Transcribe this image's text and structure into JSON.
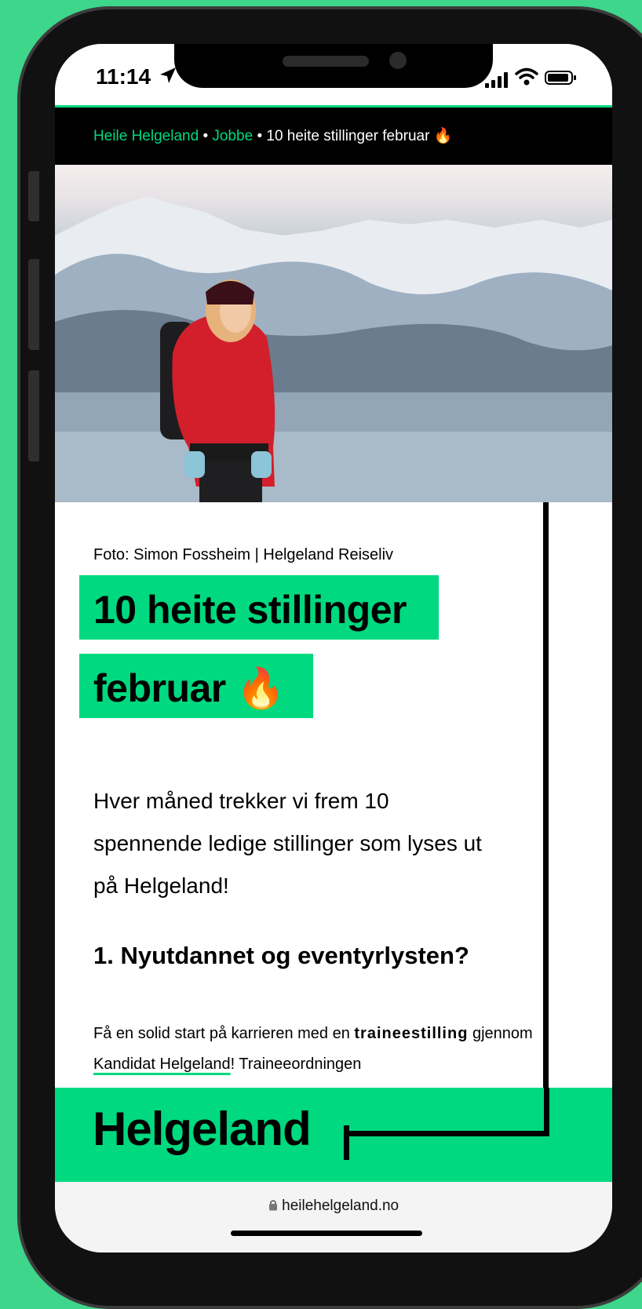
{
  "status_bar": {
    "time": "11:14",
    "location_icon": "location-arrow-icon",
    "signal_icon": "signal-icon",
    "wifi_icon": "wifi-icon",
    "battery_icon": "battery-icon"
  },
  "breadcrumb": {
    "items": [
      {
        "label": "Heile Helgeland",
        "link": true
      },
      {
        "label": "Jobbe",
        "link": true
      },
      {
        "label": "10 heite stillinger februar 🔥",
        "link": false
      }
    ],
    "separator": "•"
  },
  "article": {
    "photo_caption": "Foto: Simon Fossheim | Helgeland Reiseliv",
    "title_line1": "10 heite stillinger",
    "title_line2": "februar 🔥",
    "intro": "Hver måned trekker vi frem 10 spennende ledige stillinger som lyses ut på Helgeland!",
    "section_heading": "1. Nyutdannet og eventyrlysten?",
    "paragraph_part1": "Få en solid start på karrieren med en",
    "paragraph_bold": "traineestilling",
    "paragraph_part2": "gjennom",
    "paragraph_link": "Kandidat Helgeland",
    "paragraph_part3": "! Traineeordningen"
  },
  "footer": {
    "brand": "Helgeland"
  },
  "browser": {
    "url": "heilehelgeland.no",
    "lock_icon": "lock-icon"
  },
  "colors": {
    "accent": "#00d97f",
    "background": "#3ed68a",
    "dark": "#000000"
  }
}
